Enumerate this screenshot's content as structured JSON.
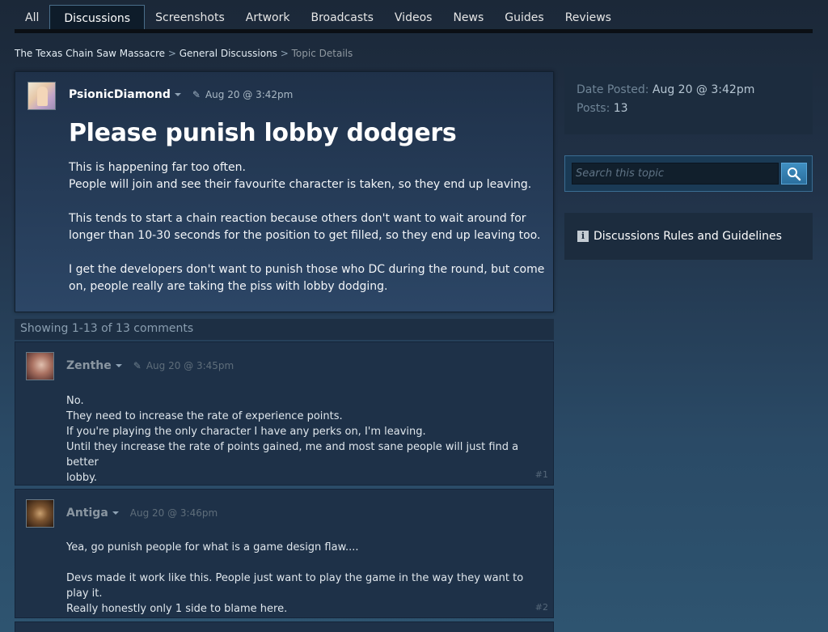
{
  "tabs": [
    {
      "label": "All"
    },
    {
      "label": "Discussions"
    },
    {
      "label": "Screenshots"
    },
    {
      "label": "Artwork"
    },
    {
      "label": "Broadcasts"
    },
    {
      "label": "Videos"
    },
    {
      "label": "News"
    },
    {
      "label": "Guides"
    },
    {
      "label": "Reviews"
    }
  ],
  "breadcrumb": {
    "game": "The Texas Chain Saw Massacre",
    "section": "General Discussions",
    "current": "Topic Details",
    "separator": ">"
  },
  "op": {
    "author": "PsionicDiamond",
    "date": "Aug 20 @ 3:42pm",
    "title": "Please punish lobby dodgers",
    "paragraphs": [
      [
        "This is happening far too often.",
        "People will join and see their favourite character is taken, so they end up leaving."
      ],
      [
        "This tends to start a chain reaction because others don't want to wait around for",
        "longer than 10-30 seconds for the position to get filled, so they end up leaving too."
      ],
      [
        "I get the developers don't want to punish those who DC during the round, but come",
        "on, people really are taking the piss with lobby dodging."
      ]
    ]
  },
  "comment_count": "Showing 1-13 of 13 comments",
  "comments": [
    {
      "author": "Zenthe",
      "date": "Aug 20 @ 3:45pm",
      "lines": [
        "No.",
        "They need to increase the rate of experience points.",
        "If you're playing the only character I have any perks on, I'm leaving.",
        "Until they increase the rate of points gained, me and most sane people will just find a better",
        "lobby."
      ],
      "number": "#1"
    },
    {
      "author": "Antiga",
      "date": "Aug 20 @ 3:46pm",
      "lines": [
        "Yea, go punish people for what is a game design flaw....",
        "",
        "Devs made it work like this. People just want to play the game in the way they want to play it.",
        "Really honestly only 1 side to blame here."
      ],
      "number": "#2"
    }
  ],
  "sidebar": {
    "date_posted_label": "Date Posted:",
    "date_posted_value": "Aug 20 @ 3:42pm",
    "posts_label": "Posts:",
    "posts_value": "13",
    "search_placeholder": "Search this topic",
    "rules_label": "Discussions Rules and Guidelines"
  },
  "colors": {
    "accent": "#3f8fc2",
    "background": "#1b2838"
  }
}
